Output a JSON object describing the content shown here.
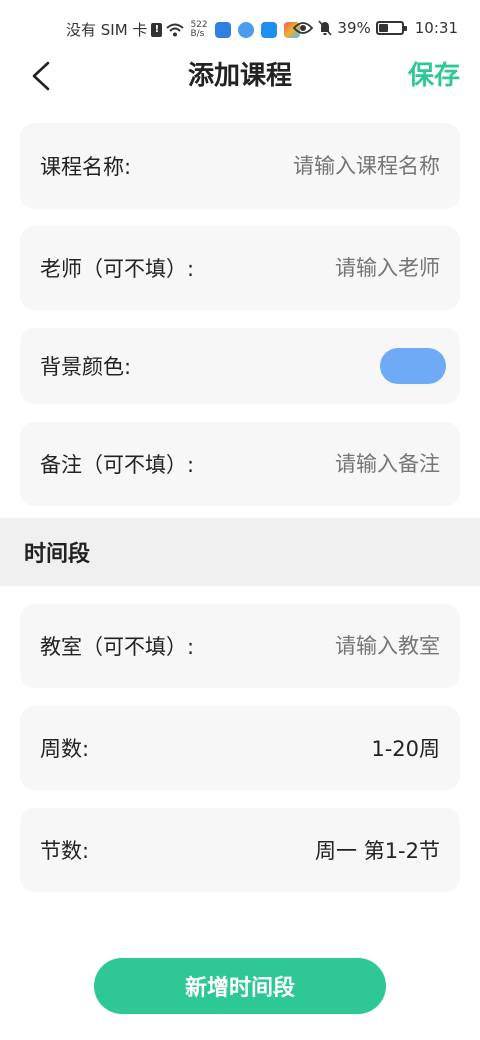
{
  "status_bar": {
    "sim_text": "没有 SIM 卡",
    "net_speed_value": "522",
    "net_speed_unit": "B/s",
    "battery_percent": "39%",
    "battery_level": 0.39,
    "time": "10:31"
  },
  "header": {
    "title": "添加课程",
    "save_label": "保存"
  },
  "form": {
    "course_name": {
      "label": "课程名称:",
      "placeholder": "请输入课程名称",
      "value": ""
    },
    "teacher": {
      "label": "老师（可不填）:",
      "placeholder": "请输入老师",
      "value": ""
    },
    "bg_color": {
      "label": "背景颜色:",
      "color": "#6eaaf5"
    },
    "note": {
      "label": "备注（可不填）:",
      "placeholder": "请输入备注",
      "value": ""
    }
  },
  "time_section": {
    "title": "时间段",
    "classroom": {
      "label": "教室（可不填）:",
      "placeholder": "请输入教室",
      "value": ""
    },
    "weeks": {
      "label": "周数:",
      "value": "1-20周"
    },
    "periods": {
      "label": "节数:",
      "value": "周一 第1-2节"
    }
  },
  "add_button_label": "新增时间段",
  "colors": {
    "accent": "#2ec896",
    "card_bg": "#f7f7f7",
    "section_bg": "#f0f0f0",
    "placeholder": "#a8a8a8"
  }
}
